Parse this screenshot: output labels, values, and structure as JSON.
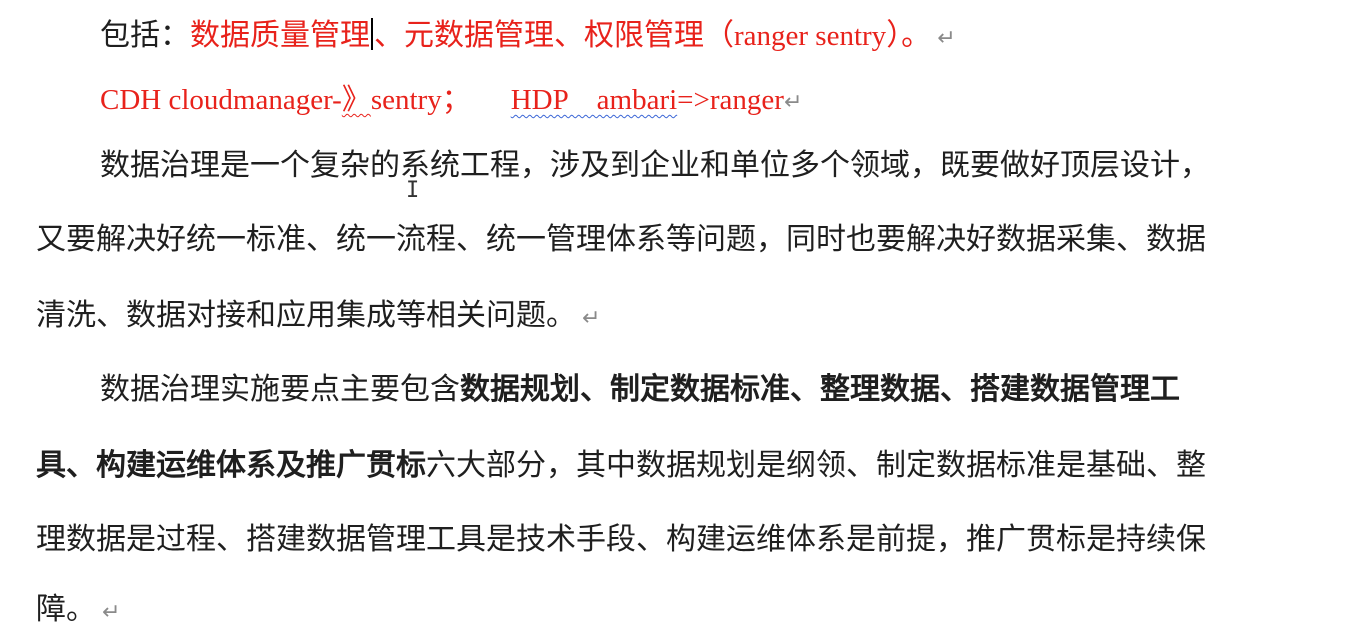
{
  "para1": {
    "prefix": "包括：",
    "item1": "数据质量管理",
    "rest": "、元数据管理、权限管理（",
    "latin": "ranger sentry",
    "close": "）。"
  },
  "para2": {
    "cdh": "CDH cloudmanager-",
    "arrow": "》",
    "sentry": "sentry；",
    "hdp_ambari": "HDP    ambari",
    "ranger": "=>ranger"
  },
  "para3": {
    "line1": "数据治理是一个复杂的系统工程，涉及到企业和单位多个领域，既要做好顶层设计，",
    "line2": "又要解决好统一标准、统一流程、统一管理体系等问题，同时也要解决好数据采集、数据",
    "line3": "清洗、数据对接和应用集成等相关问题。"
  },
  "para4": {
    "line1_normal": "数据治理实施要点主要包含",
    "line1_bold": "数据规划、制定数据标准、整理数据、搭建数据管理工",
    "line2_bold": "具、构建运维体系及推广贯标",
    "line2_normal": "六大部分，其中数据规划是纲领、制定数据标准是基础、整",
    "line3": "理数据是过程、搭建数据管理工具是技术手段、构建运维体系是前提，推广贯标是持续保",
    "line4": "障。"
  },
  "paragraph_mark": "↵",
  "icons": {
    "paragraph_mark": "paragraph-mark-icon",
    "text_cursor": "ibeam-cursor-icon"
  },
  "colors": {
    "red_text": "#e8221b",
    "body_text": "#1f1f1f",
    "paragraph_mark": "#8a8a8a",
    "spell_squiggle": "#e8221b",
    "grammar_squiggle": "#3b66d6"
  }
}
